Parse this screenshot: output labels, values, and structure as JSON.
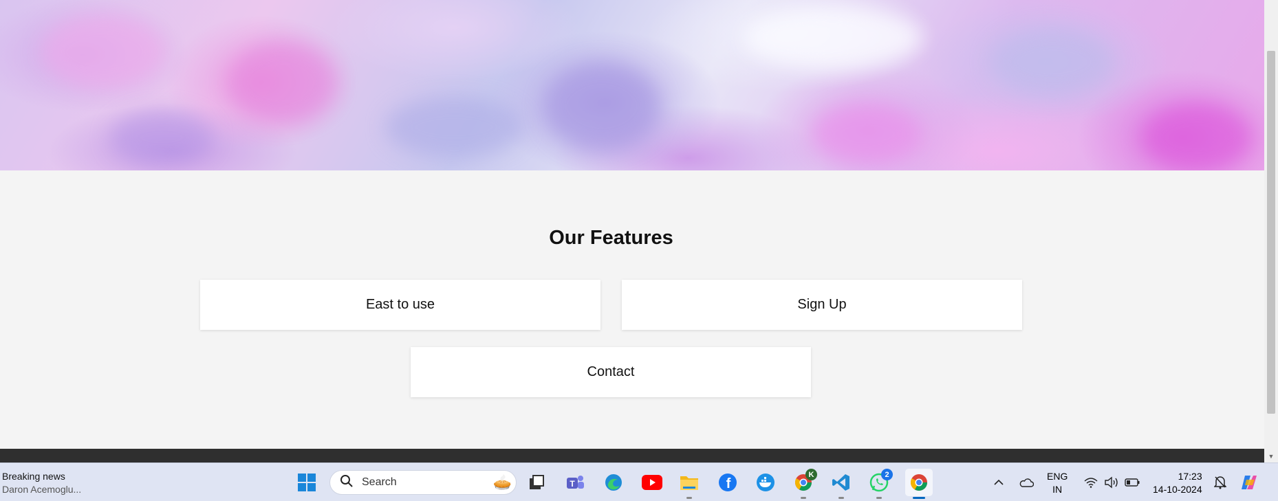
{
  "features": {
    "heading": "Our Features",
    "cards": [
      "East to use",
      "Sign Up",
      "Contact"
    ]
  },
  "taskbar": {
    "news_title": "Breaking news",
    "news_sub": "Daron Acemoglu...",
    "search_placeholder": "Search",
    "whatsapp_badge": "2",
    "chrome_profile_badge": "K",
    "lang_line1": "ENG",
    "lang_line2": "IN",
    "time": "17:23",
    "date": "14-10-2024"
  },
  "icons": [
    "windows-start-icon",
    "search-icon",
    "task-view-icon",
    "teams-icon",
    "edge-icon",
    "youtube-icon",
    "file-explorer-icon",
    "facebook-icon",
    "docker-icon",
    "chrome-profile-icon",
    "vscode-icon",
    "whatsapp-icon",
    "chrome-icon",
    "chevron-up-icon",
    "onedrive-icon",
    "wifi-icon",
    "volume-icon",
    "battery-icon",
    "notification-icon",
    "copilot-icon"
  ]
}
